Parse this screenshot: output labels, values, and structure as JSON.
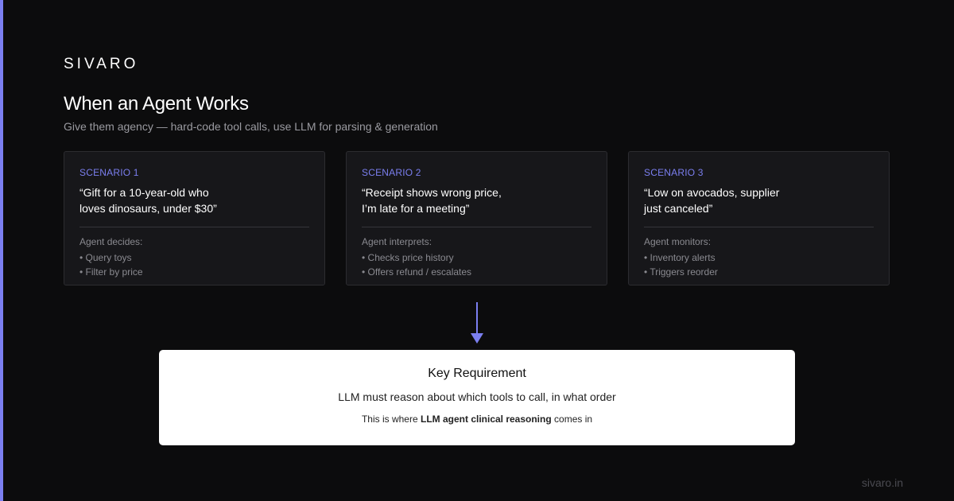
{
  "brand": "SIVARO",
  "title": "When an Agent Works",
  "subtitle": "Give them agency — hard-code tool calls, use LLM for parsing & generation",
  "colors": {
    "accent": "#7b7ff0",
    "background": "#0c0c0d",
    "card": "#17171a"
  },
  "scenarios": [
    {
      "label": "SCENARIO 1",
      "quote": "“Gift for a 10-year-old who\nloves dinosaurs, under $30”",
      "heading": "Agent decides:",
      "items": [
        "• Query toys",
        "• Filter by price"
      ]
    },
    {
      "label": "SCENARIO 2",
      "quote": "“Receipt shows wrong price,\nI’m late for a meeting”",
      "heading": "Agent interprets:",
      "items": [
        "• Checks price history",
        "• Offers refund / escalates"
      ]
    },
    {
      "label": "SCENARIO 3",
      "quote": "“Low on avocados, supplier\njust canceled”",
      "heading": "Agent monitors:",
      "items": [
        "• Inventory alerts",
        "• Triggers reorder"
      ]
    }
  ],
  "key": {
    "title": "Key Requirement",
    "line": "LLM must reason about which tools to call, in what order",
    "note_prefix": "This is where ",
    "note_bold": "LLM agent clinical reasoning",
    "note_suffix": " comes in"
  },
  "footer": "sivaro.in"
}
